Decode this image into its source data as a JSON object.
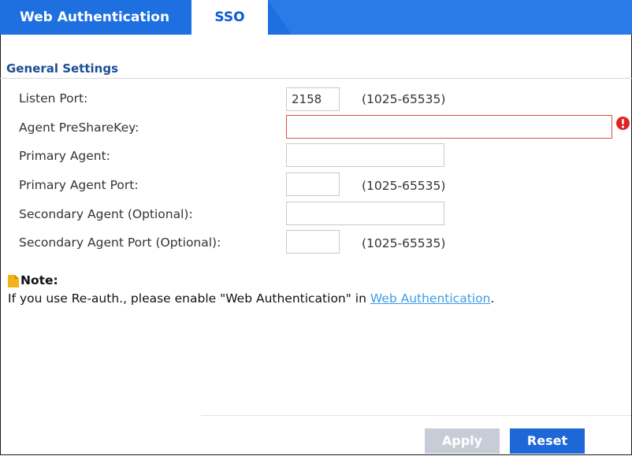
{
  "tabs": [
    {
      "label": "Web Authentication",
      "active": false
    },
    {
      "label": "SSO",
      "active": true
    }
  ],
  "section_title": "General Settings",
  "fields": {
    "listen_port": {
      "label": "Listen Port:",
      "value": "2158",
      "hint": "(1025-65535)"
    },
    "agent_presharekey": {
      "label": "Agent PreShareKey:",
      "value": "",
      "error": true
    },
    "primary_agent": {
      "label": "Primary Agent:",
      "value": ""
    },
    "primary_agent_port": {
      "label": "Primary Agent Port:",
      "value": "",
      "hint": "(1025-65535)"
    },
    "secondary_agent": {
      "label": "Secondary Agent (Optional):",
      "value": ""
    },
    "secondary_agent_port": {
      "label": "Secondary Agent Port (Optional):",
      "value": "",
      "hint": "(1025-65535)"
    }
  },
  "note": {
    "title": "Note:",
    "text_before": "If you use Re-auth., please enable \"Web Authentication\" in ",
    "link": "Web Authentication",
    "text_after": "."
  },
  "buttons": {
    "apply": "Apply",
    "reset": "Reset"
  },
  "colors": {
    "tab_bar": "#1e6fe0",
    "active_tab_text": "#0a5bd3",
    "section_title": "#1d4e94",
    "error": "#e02424",
    "link": "#3d9ce6",
    "apply_disabled": "#c7ccd6",
    "reset": "#1e67d9"
  },
  "icons": {
    "error": "exclamation-circle-icon",
    "note": "document-note-icon"
  }
}
